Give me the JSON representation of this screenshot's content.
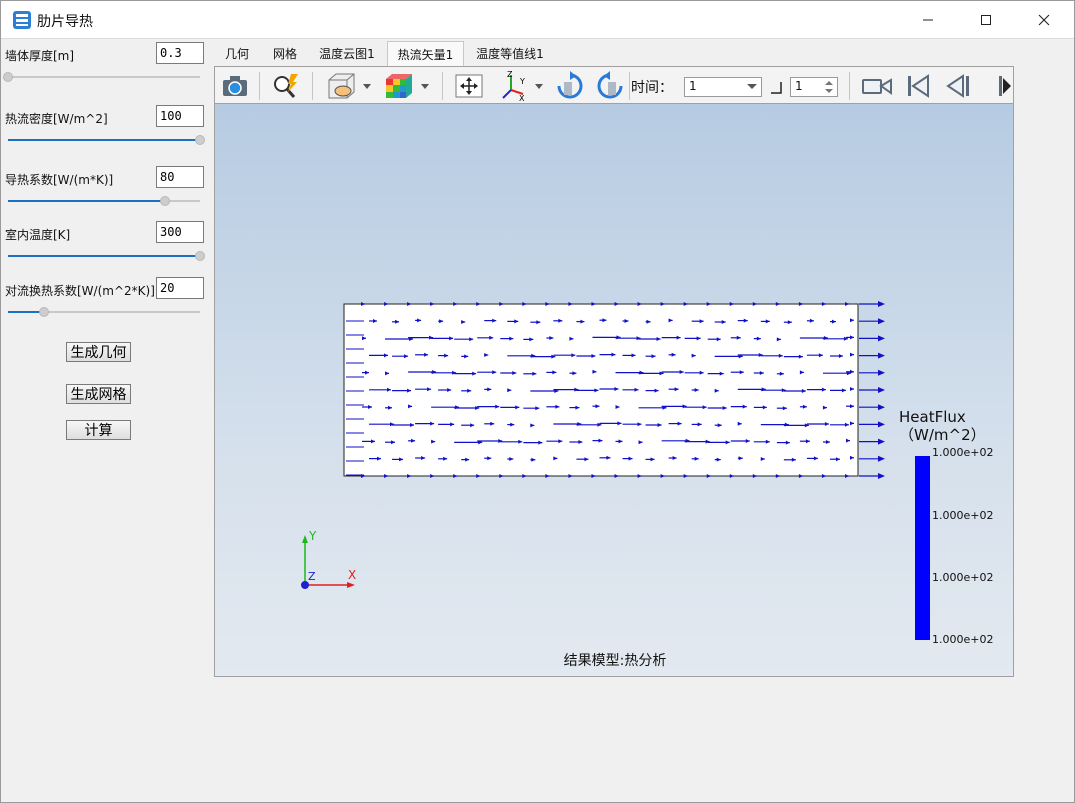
{
  "window": {
    "title": "肋片导热",
    "icon": "app-icon",
    "controls": {
      "minimize": "minimize-icon",
      "maximize": "maximize-icon",
      "close": "close-icon"
    }
  },
  "params": [
    {
      "label": "墙体厚度[m]",
      "value": "0.3",
      "slider_fraction": 0.0
    },
    {
      "label": "热流密度[W/m^2]",
      "value": "100",
      "slider_fraction": 1.0
    },
    {
      "label": "导热系数[W/(m*K)]",
      "value": "80",
      "slider_fraction": 0.82
    },
    {
      "label": "室内温度[K]",
      "value": "300",
      "slider_fraction": 1.0
    },
    {
      "label": "对流换热系数[W/(m^2*K)]",
      "value": "20",
      "slider_fraction": 0.19
    }
  ],
  "buttons": {
    "gen_geometry": "生成几何",
    "gen_mesh": "生成网格",
    "compute": "计算"
  },
  "tabs": [
    "几何",
    "网格",
    "温度云图1",
    "热流矢量1",
    "温度等值线1"
  ],
  "active_tab": "热流矢量1",
  "toolbar": {
    "icons": [
      "camera-icon",
      "query-icon",
      "clip-plane-icon",
      "color-cube-icon",
      "fit-view-icon",
      "axes-orient-icon",
      "rotate-cw-icon",
      "rotate-ccw-icon",
      "record-icon",
      "first-frame-icon",
      "prev-frame-icon",
      "next-frame-icon"
    ],
    "time_label": "时间：",
    "time_value": "1",
    "step_value": "1"
  },
  "viewport": {
    "footer": "结果模型:热分析",
    "axis_labels": {
      "x": "X",
      "y": "Y",
      "z": "Z"
    },
    "legend": {
      "title": "HeatFlux",
      "unit": "（W/m^2）",
      "ticks": [
        "1.000e+02",
        "1.000e+02",
        "1.000e+02",
        "1.000e+02"
      ],
      "color": "#0000ff"
    },
    "vector_color": "#1010c8"
  }
}
